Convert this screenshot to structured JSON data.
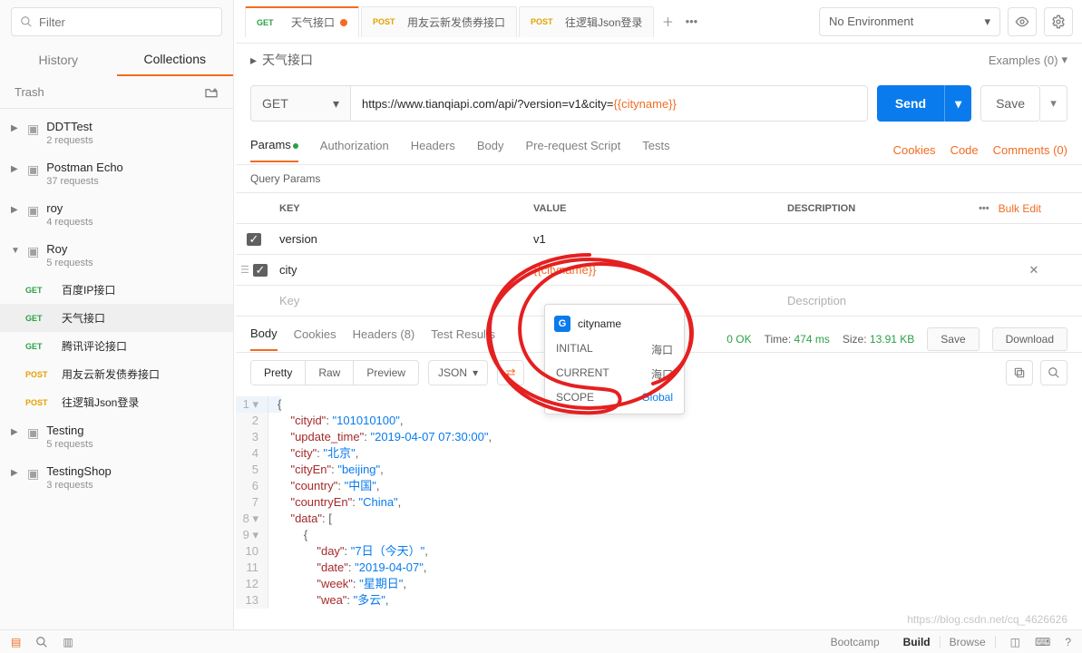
{
  "sidebar": {
    "filter_placeholder": "Filter",
    "tabs": {
      "history": "History",
      "collections": "Collections"
    },
    "trash": "Trash",
    "folders": [
      {
        "name": "DDTTest",
        "sub": "2 requests",
        "expanded": false
      },
      {
        "name": "Postman Echo",
        "sub": "37 requests",
        "expanded": false
      },
      {
        "name": "roy",
        "sub": "4 requests",
        "expanded": false
      },
      {
        "name": "Roy",
        "sub": "5 requests",
        "expanded": true
      },
      {
        "name": "Testing",
        "sub": "5 requests",
        "expanded": false
      },
      {
        "name": "TestingShop",
        "sub": "3 requests",
        "expanded": false
      }
    ],
    "roy_items": [
      {
        "method": "GET",
        "name": "百度IP接口"
      },
      {
        "method": "GET",
        "name": "天气接口"
      },
      {
        "method": "GET",
        "name": "腾讯评论接口"
      },
      {
        "method": "POST",
        "name": "用友云新发债券接口"
      },
      {
        "method": "POST",
        "name": "往逻辑Json登录"
      }
    ],
    "selected_item": 1
  },
  "top": {
    "tabs": [
      {
        "method": "GET",
        "label": "天气接口",
        "dirty": true
      },
      {
        "method": "POST",
        "label": "用友云新发债券接口",
        "dirty": false
      },
      {
        "method": "POST",
        "label": "往逻辑Json登录",
        "dirty": false
      }
    ],
    "env": "No Environment"
  },
  "breadcrumb": {
    "title": "天气接口",
    "examples": "Examples (0)"
  },
  "request": {
    "method": "GET",
    "url_prefix": "https://www.tianqiapi.com/api/?version=v1&city=",
    "url_var": "{{cityname}}",
    "send": "Send",
    "save": "Save"
  },
  "subtabs": {
    "params": "Params",
    "authorization": "Authorization",
    "headers": "Headers",
    "body": "Body",
    "prerequest": "Pre-request Script",
    "tests": "Tests",
    "cookies": "Cookies",
    "code": "Code",
    "comments": "Comments (0)"
  },
  "query": {
    "title": "Query Params",
    "head_key": "KEY",
    "head_value": "VALUE",
    "head_desc": "DESCRIPTION",
    "bulk": "Bulk Edit",
    "rows": [
      {
        "key": "version",
        "value": "v1",
        "var": false
      },
      {
        "key": "city",
        "value": "{{cityname}}",
        "var": true
      }
    ],
    "key_ph": "Key",
    "value_ph": "Value",
    "desc_ph": "Description"
  },
  "tooltip": {
    "name": "cityname",
    "initial_label": "INITIAL",
    "initial_val": "海口",
    "current_label": "CURRENT",
    "current_val": "海口",
    "scope_label": "SCOPE",
    "scope_val": "Global"
  },
  "response": {
    "tabs": {
      "body": "Body",
      "cookies": "Cookies",
      "headers": "Headers (8)",
      "tests": "Test Results"
    },
    "status_raw": "0 OK",
    "time_label": "Time:",
    "time_val": "474 ms",
    "size_label": "Size:",
    "size_val": "13.91 KB",
    "save": "Save",
    "download": "Download",
    "views": {
      "pretty": "Pretty",
      "raw": "Raw",
      "preview": "Preview"
    },
    "format": "JSON",
    "json": {
      "cityid": "101010100",
      "update_time": "2019-04-07 07:30:00",
      "city": "北京",
      "cityEn": "beijing",
      "country": "中国",
      "countryEn": "China",
      "data0": {
        "day": "7日（今天）",
        "date": "2019-04-07",
        "week": "星期日",
        "wea": "多云"
      }
    }
  },
  "footer": {
    "bootcamp": "Bootcamp",
    "build": "Build",
    "browse": "Browse"
  },
  "watermark": "https://blog.csdn.net/cq_4626626"
}
